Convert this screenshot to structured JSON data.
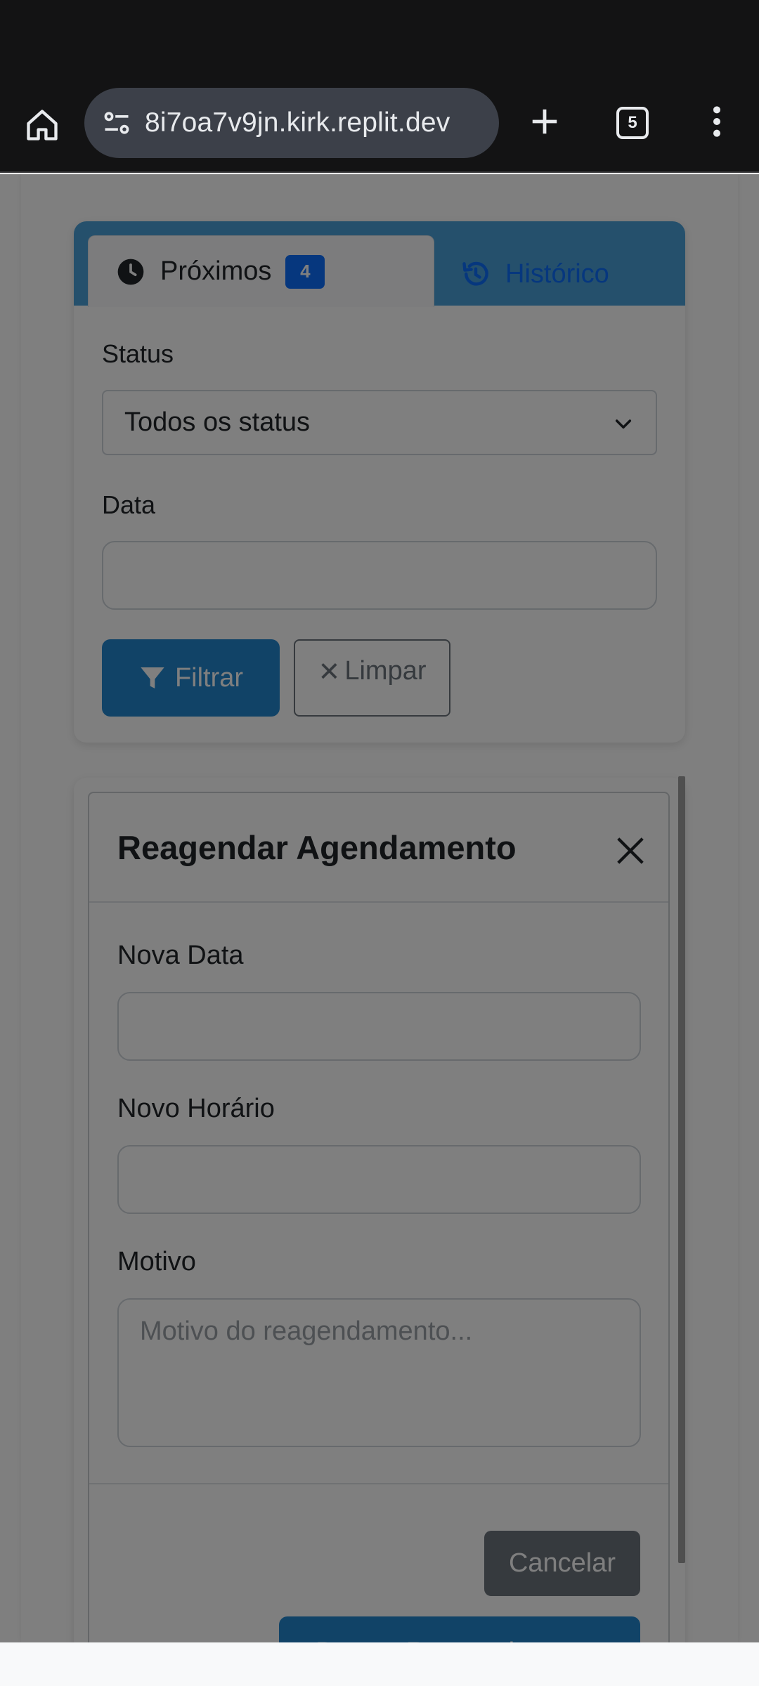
{
  "browser": {
    "url": "8i7oa7v9jn.kirk.replit.dev",
    "tab_count": "5",
    "icons": {
      "home": "home-icon",
      "site_info": "tune-icon",
      "new_tab": "plus-icon",
      "tabs": "tab-switcher-icon",
      "menu": "more-vert-icon"
    }
  },
  "tabs": {
    "upcoming": {
      "label": "Próximos",
      "badge": "4"
    },
    "history": {
      "label": "Histórico"
    }
  },
  "filter": {
    "status_label": "Status",
    "status_value": "Todos os status",
    "date_label": "Data",
    "date_value": "",
    "filter_button": "Filtrar",
    "clear_button": "Limpar"
  },
  "modal": {
    "title": "Reagendar Agendamento",
    "new_date_label": "Nova Data",
    "new_date_value": "",
    "new_time_label": "Novo Horário",
    "new_time_value": "",
    "reason_label": "Motivo",
    "reason_placeholder": "Motivo do reagendamento...",
    "cancel_button": "Cancelar",
    "confirm_button": "Buscar Reagendamento"
  },
  "colors": {
    "primary": "#0d6efd",
    "tab_header": "#4aa0d8",
    "filter_button": "#2287cf",
    "secondary": "#6c757d"
  }
}
